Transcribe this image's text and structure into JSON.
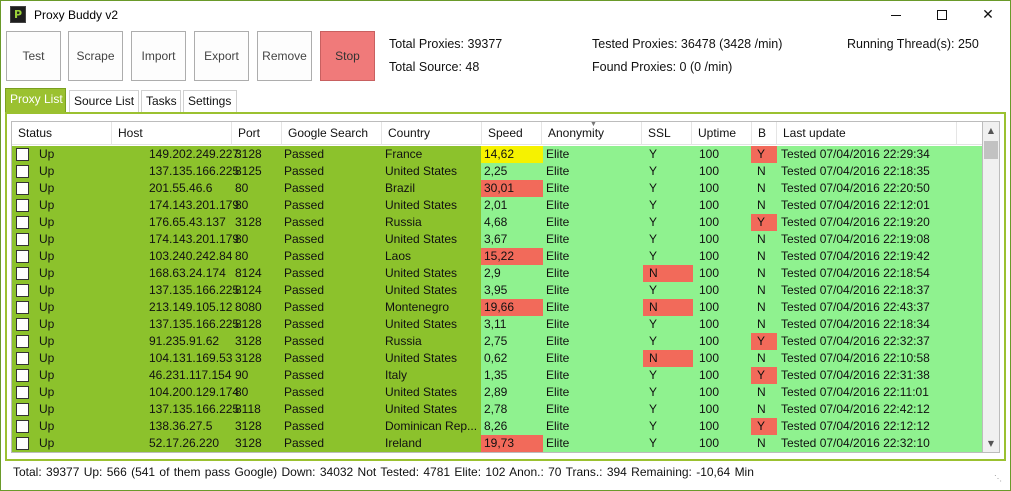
{
  "window": {
    "title": "Proxy Buddy v2",
    "app_icon_letter": "P",
    "min_icon": "minimize-icon",
    "max_icon": "maximize-icon",
    "close_icon": "close-icon",
    "close_glyph": "✕"
  },
  "toolbar": {
    "test": "Test",
    "scrape": "Scrape",
    "import": "Import",
    "export": "Export",
    "remove": "Remove",
    "stop": "Stop",
    "stop_color": "#f07a7a"
  },
  "stats": {
    "total_proxies": "Total Proxies: 39377",
    "total_source": "Total Source: 48",
    "tested_proxies": "Tested Proxies: 36478 (3428 /min)",
    "found_proxies": "Found Proxies: 0 (0 /min)",
    "running_threads": "Running Thread(s): 250"
  },
  "tabs": [
    "Proxy List",
    "Source List",
    "Tasks",
    "Settings"
  ],
  "table": {
    "columns": [
      "Status",
      "Host",
      "Port",
      "Google Search",
      "Country",
      "Speed",
      "Anonymity",
      "SSL",
      "Uptime",
      "B",
      "Last update"
    ],
    "rows": [
      {
        "status": "Up",
        "host": "149.202.249.227",
        "port": "3128",
        "google": "Passed",
        "country": "France",
        "speed": "14,62",
        "speed_flag": "yellow",
        "anon": "Elite",
        "ssl": "Y",
        "ssl_bad": false,
        "uptime": "100",
        "b": "Y",
        "b_bad": true,
        "last": "Tested 07/04/2016 22:29:34"
      },
      {
        "status": "Up",
        "host": "137.135.166.225",
        "port": "8125",
        "google": "Passed",
        "country": "United States",
        "speed": "2,25",
        "speed_flag": "",
        "anon": "Elite",
        "ssl": "Y",
        "ssl_bad": false,
        "uptime": "100",
        "b": "N",
        "b_bad": false,
        "last": "Tested 07/04/2016 22:18:35"
      },
      {
        "status": "Up",
        "host": "201.55.46.6",
        "port": "80",
        "google": "Passed",
        "country": "Brazil",
        "speed": "30,01",
        "speed_flag": "red",
        "anon": "Elite",
        "ssl": "Y",
        "ssl_bad": false,
        "uptime": "100",
        "b": "N",
        "b_bad": false,
        "last": "Tested 07/04/2016 22:20:50"
      },
      {
        "status": "Up",
        "host": "174.143.201.179",
        "port": "80",
        "google": "Passed",
        "country": "United States",
        "speed": "2,01",
        "speed_flag": "",
        "anon": "Elite",
        "ssl": "Y",
        "ssl_bad": false,
        "uptime": "100",
        "b": "N",
        "b_bad": false,
        "last": "Tested 07/04/2016 22:12:01"
      },
      {
        "status": "Up",
        "host": "176.65.43.137",
        "port": "3128",
        "google": "Passed",
        "country": "Russia",
        "speed": "4,68",
        "speed_flag": "",
        "anon": "Elite",
        "ssl": "Y",
        "ssl_bad": false,
        "uptime": "100",
        "b": "Y",
        "b_bad": true,
        "last": "Tested 07/04/2016 22:19:20"
      },
      {
        "status": "Up",
        "host": "174.143.201.179",
        "port": "80",
        "google": "Passed",
        "country": "United States",
        "speed": "3,67",
        "speed_flag": "",
        "anon": "Elite",
        "ssl": "Y",
        "ssl_bad": false,
        "uptime": "100",
        "b": "N",
        "b_bad": false,
        "last": "Tested 07/04/2016 22:19:08"
      },
      {
        "status": "Up",
        "host": "103.240.242.84",
        "port": "80",
        "google": "Passed",
        "country": "Laos",
        "speed": "15,22",
        "speed_flag": "red",
        "anon": "Elite",
        "ssl": "Y",
        "ssl_bad": false,
        "uptime": "100",
        "b": "N",
        "b_bad": false,
        "last": "Tested 07/04/2016 22:19:42"
      },
      {
        "status": "Up",
        "host": "168.63.24.174",
        "port": "8124",
        "google": "Passed",
        "country": "United States",
        "speed": "2,9",
        "speed_flag": "",
        "anon": "Elite",
        "ssl": "N",
        "ssl_bad": true,
        "uptime": "100",
        "b": "N",
        "b_bad": false,
        "last": "Tested 07/04/2016 22:18:54"
      },
      {
        "status": "Up",
        "host": "137.135.166.225",
        "port": "8124",
        "google": "Passed",
        "country": "United States",
        "speed": "3,95",
        "speed_flag": "",
        "anon": "Elite",
        "ssl": "Y",
        "ssl_bad": false,
        "uptime": "100",
        "b": "N",
        "b_bad": false,
        "last": "Tested 07/04/2016 22:18:37"
      },
      {
        "status": "Up",
        "host": "213.149.105.12",
        "port": "8080",
        "google": "Passed",
        "country": "Montenegro",
        "speed": "19,66",
        "speed_flag": "red",
        "anon": "Elite",
        "ssl": "N",
        "ssl_bad": true,
        "uptime": "100",
        "b": "N",
        "b_bad": false,
        "last": "Tested 07/04/2016 22:43:37"
      },
      {
        "status": "Up",
        "host": "137.135.166.225",
        "port": "8128",
        "google": "Passed",
        "country": "United States",
        "speed": "3,11",
        "speed_flag": "",
        "anon": "Elite",
        "ssl": "Y",
        "ssl_bad": false,
        "uptime": "100",
        "b": "N",
        "b_bad": false,
        "last": "Tested 07/04/2016 22:18:34"
      },
      {
        "status": "Up",
        "host": "91.235.91.62",
        "port": "3128",
        "google": "Passed",
        "country": "Russia",
        "speed": "2,75",
        "speed_flag": "",
        "anon": "Elite",
        "ssl": "Y",
        "ssl_bad": false,
        "uptime": "100",
        "b": "Y",
        "b_bad": true,
        "last": "Tested 07/04/2016 22:32:37"
      },
      {
        "status": "Up",
        "host": "104.131.169.53",
        "port": "3128",
        "google": "Passed",
        "country": "United States",
        "speed": "0,62",
        "speed_flag": "",
        "anon": "Elite",
        "ssl": "N",
        "ssl_bad": true,
        "uptime": "100",
        "b": "N",
        "b_bad": false,
        "last": "Tested 07/04/2016 22:10:58"
      },
      {
        "status": "Up",
        "host": "46.231.117.154",
        "port": "90",
        "google": "Passed",
        "country": "Italy",
        "speed": "1,35",
        "speed_flag": "",
        "anon": "Elite",
        "ssl": "Y",
        "ssl_bad": false,
        "uptime": "100",
        "b": "Y",
        "b_bad": true,
        "last": "Tested 07/04/2016 22:31:38"
      },
      {
        "status": "Up",
        "host": "104.200.129.174",
        "port": "80",
        "google": "Passed",
        "country": "United States",
        "speed": "2,89",
        "speed_flag": "",
        "anon": "Elite",
        "ssl": "Y",
        "ssl_bad": false,
        "uptime": "100",
        "b": "N",
        "b_bad": false,
        "last": "Tested 07/04/2016 22:11:01"
      },
      {
        "status": "Up",
        "host": "137.135.166.225",
        "port": "8118",
        "google": "Passed",
        "country": "United States",
        "speed": "2,78",
        "speed_flag": "",
        "anon": "Elite",
        "ssl": "Y",
        "ssl_bad": false,
        "uptime": "100",
        "b": "N",
        "b_bad": false,
        "last": "Tested 07/04/2016 22:42:12"
      },
      {
        "status": "Up",
        "host": "138.36.27.5",
        "port": "3128",
        "google": "Passed",
        "country": "Dominican Rep...",
        "speed": "8,26",
        "speed_flag": "",
        "anon": "Elite",
        "ssl": "Y",
        "ssl_bad": false,
        "uptime": "100",
        "b": "Y",
        "b_bad": true,
        "last": "Tested 07/04/2016 22:12:12"
      },
      {
        "status": "Up",
        "host": "52.17.26.220",
        "port": "3128",
        "google": "Passed",
        "country": "Ireland",
        "speed": "19,73",
        "speed_flag": "red",
        "anon": "Elite",
        "ssl": "Y",
        "ssl_bad": false,
        "uptime": "100",
        "b": "N",
        "b_bad": false,
        "last": "Tested 07/04/2016 22:32:10"
      }
    ]
  },
  "statusbar": {
    "text": "Total:  39377  Up:  566 (541 of them pass Google)  Down:  34032  Not Tested:  4781  Elite:  102  Anon.:  70  Trans.:  394  Remaining:  -10,64 Min"
  },
  "colors": {
    "accent": "#9bc130",
    "status_green": "#8cc22c",
    "good_green": "#8ff28f",
    "bad_red": "#f26a5a",
    "warn_yellow": "#f6f200"
  }
}
